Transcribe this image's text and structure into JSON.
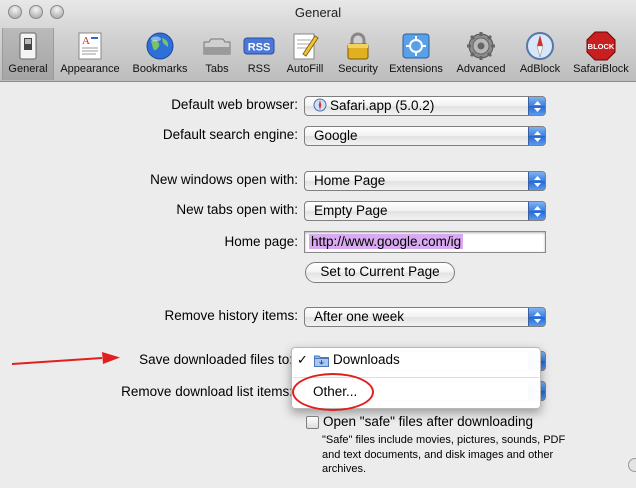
{
  "window": {
    "title": "General"
  },
  "toolbar": {
    "items": [
      {
        "id": "general",
        "label": "General"
      },
      {
        "id": "appearance",
        "label": "Appearance"
      },
      {
        "id": "bookmarks",
        "label": "Bookmarks"
      },
      {
        "id": "tabs",
        "label": "Tabs"
      },
      {
        "id": "rss",
        "label": "RSS",
        "icon_text": "RSS"
      },
      {
        "id": "autofill",
        "label": "AutoFill"
      },
      {
        "id": "security",
        "label": "Security"
      },
      {
        "id": "extensions",
        "label": "Extensions"
      },
      {
        "id": "advanced",
        "label": "Advanced"
      },
      {
        "id": "adblock",
        "label": "AdBlock"
      },
      {
        "id": "safariblock",
        "label": "SafariBlock",
        "icon_text": "BLOCK"
      }
    ],
    "selected": "general"
  },
  "form": {
    "default_browser": {
      "label": "Default web browser:",
      "value": "Safari.app (5.0.2)"
    },
    "default_search": {
      "label": "Default search engine:",
      "value": "Google"
    },
    "new_windows": {
      "label": "New windows open with:",
      "value": "Home Page"
    },
    "new_tabs": {
      "label": "New tabs open with:",
      "value": "Empty Page"
    },
    "home_page": {
      "label": "Home page:",
      "value": "http://www.google.com/ig"
    },
    "set_current_button": "Set to Current Page",
    "remove_history": {
      "label": "Remove history items:",
      "value": "After one week"
    },
    "save_downloads": {
      "label": "Save downloaded files to:"
    },
    "remove_download_list": {
      "label": "Remove download list items:"
    },
    "open_safe": {
      "label": "Open \"safe\" files after downloading",
      "help": "\"Safe\" files include movies, pictures, sounds, PDF and text documents, and disk images and other archives."
    }
  },
  "menu": {
    "items": [
      {
        "label": "Downloads",
        "checked": true,
        "checkmark": "✓"
      },
      {
        "label": "Other..."
      }
    ]
  },
  "colors": {
    "annotation_red": "#e0201e",
    "selection_highlight": "#d9a9f2",
    "popup_blue": "#3a7fe0"
  }
}
